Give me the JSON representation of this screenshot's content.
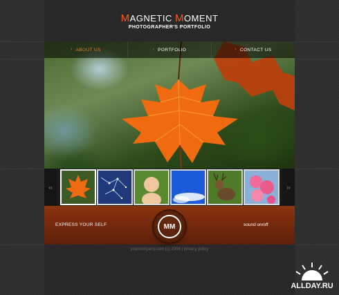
{
  "brand": {
    "title_first_cap": "M",
    "title_first_rest": "agnetic ",
    "title_second_cap": "M",
    "title_second_rest": "oment",
    "subtitle": "PHOTOGRAPHER'S PORTFOLIO"
  },
  "nav": {
    "items": [
      {
        "label": "ABOUT US",
        "active": true
      },
      {
        "label": "PORTFOLIO",
        "active": false
      },
      {
        "label": "CONTACT US",
        "active": false
      }
    ]
  },
  "gallery": {
    "prev_label": "‹‹",
    "next_label": "››",
    "thumbs": [
      {
        "name": "autumn-leaf",
        "active": true
      },
      {
        "name": "constellation-map",
        "active": false
      },
      {
        "name": "baby",
        "active": false
      },
      {
        "name": "blue-sky",
        "active": false
      },
      {
        "name": "deer",
        "active": false
      },
      {
        "name": "pink-blossoms",
        "active": false
      }
    ]
  },
  "bottom_bar": {
    "tagline": "EXPRESS YOUR SELF",
    "logo_text": "MM",
    "sound_label": "sound on/off"
  },
  "footer": {
    "text": "yourcompany.com (c) 2008 | privacy policy"
  },
  "watermark": {
    "text": "ALLDAY.RU"
  },
  "colors": {
    "accent": "#ff5a1f",
    "bar": "#7a2c0e",
    "background": "#2e2e2e"
  }
}
